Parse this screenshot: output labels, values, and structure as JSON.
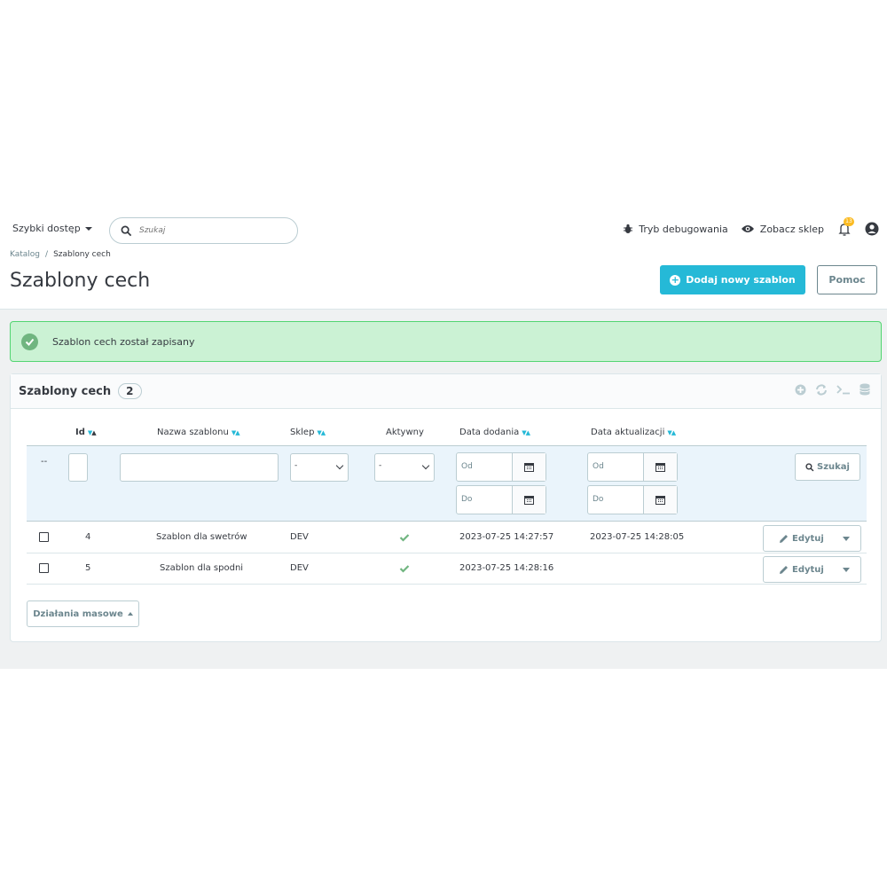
{
  "header": {
    "quick_access": "Szybki dostęp",
    "search_placeholder": "Szukaj",
    "debug_mode": "Tryb debugowania",
    "view_shop": "Zobacz sklep",
    "notifications_count": "13"
  },
  "breadcrumb": {
    "parent": "Katalog",
    "separator": "/",
    "current": "Szablony cech"
  },
  "page": {
    "title": "Szablony cech",
    "add_button": "Dodaj nowy szablon",
    "help_button": "Pomoc"
  },
  "alert": {
    "message": "Szablon cech został zapisany"
  },
  "card": {
    "title": "Szablony cech",
    "count": "2",
    "columns": {
      "id": "Id",
      "name": "Nazwa szablonu",
      "shop": "Sklep",
      "active": "Aktywny",
      "date_add": "Data dodania",
      "date_upd": "Data aktualizacji"
    },
    "filters": {
      "dash": "--",
      "shop_select": "-",
      "active_select": "-",
      "from": "Od",
      "to": "Do",
      "search_button": "Szukaj"
    },
    "rows": [
      {
        "id": "4",
        "name": "Szablon dla swetrów",
        "shop": "DEV",
        "active": true,
        "date_add": "2023-07-25 14:27:57",
        "date_upd": "2023-07-25 14:28:05",
        "edit": "Edytuj"
      },
      {
        "id": "5",
        "name": "Szablon dla spodni",
        "shop": "DEV",
        "active": true,
        "date_add": "2023-07-25 14:28:16",
        "date_upd": "",
        "edit": "Edytuj"
      }
    ],
    "bulk_actions": "Działania masowe"
  },
  "colors": {
    "primary": "#25b9d7",
    "success_bg": "#cbf2d4",
    "success_icon": "#70b580"
  }
}
